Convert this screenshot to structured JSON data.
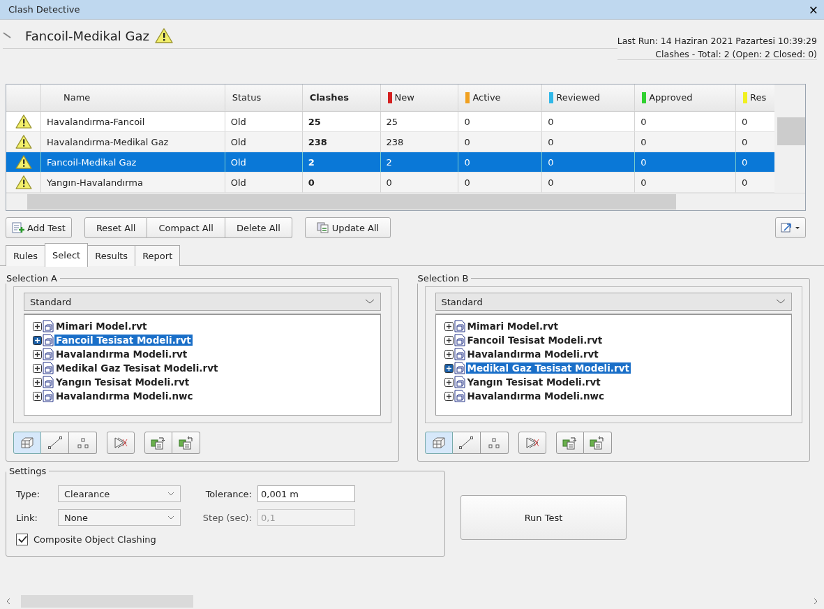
{
  "window": {
    "title": "Clash Detective",
    "close": "×"
  },
  "test": {
    "name": "Fancoil-Medikal Gaz",
    "last_run": "Last Run: 14 Haziran 2021 Pazartesi 10:39:29",
    "summary": "Clashes -  Total: 2  (Open: 2  Closed: 0)"
  },
  "table": {
    "columns": [
      {
        "label": "Name",
        "bold": false
      },
      {
        "label": "Status",
        "bold": false
      },
      {
        "label": "Clashes",
        "bold": true
      },
      {
        "label": "New",
        "bold": false,
        "color": "#d42020"
      },
      {
        "label": "Active",
        "bold": false,
        "color": "#f0a020"
      },
      {
        "label": "Reviewed",
        "bold": false,
        "color": "#30b8e8"
      },
      {
        "label": "Approved",
        "bold": false,
        "color": "#30d030"
      },
      {
        "label": "Res",
        "bold": false,
        "color": "#f0f020"
      }
    ],
    "rows": [
      {
        "selected": false,
        "cells": [
          "Havalandırma-Fancoil",
          "Old",
          "25",
          "25",
          "0",
          "0",
          "0",
          "0"
        ]
      },
      {
        "selected": false,
        "cells": [
          "Havalandırma-Medikal Gaz",
          "Old",
          "238",
          "238",
          "0",
          "0",
          "0",
          "0"
        ]
      },
      {
        "selected": true,
        "cells": [
          "Fancoil-Medikal Gaz",
          "Old",
          "2",
          "2",
          "0",
          "0",
          "0",
          "0"
        ]
      },
      {
        "selected": false,
        "cells": [
          "Yangın-Havalandırma",
          "Old",
          "0",
          "0",
          "0",
          "0",
          "0",
          "0"
        ]
      }
    ]
  },
  "toolbar": [
    [
      {
        "label": "Add Test",
        "kind": "add"
      }
    ],
    [
      {
        "label": "Reset All",
        "kind": "plain"
      },
      {
        "label": "Compact All",
        "kind": "plain"
      },
      {
        "label": "Delete All",
        "kind": "plain"
      }
    ],
    [
      {
        "label": "Update All",
        "kind": "update"
      }
    ]
  ],
  "tabs": [
    {
      "label": "Rules",
      "selected": false
    },
    {
      "label": "Select",
      "selected": true
    },
    {
      "label": "Results",
      "selected": false
    },
    {
      "label": "Report",
      "selected": false
    }
  ],
  "selections": [
    {
      "title": "Selection A",
      "dropdown": "Standard",
      "items": [
        {
          "label": "Mimari Model.rvt",
          "selected": false
        },
        {
          "label": "Fancoil Tesisat Modeli.rvt",
          "selected": true
        },
        {
          "label": "Havalandırma Modeli.rvt",
          "selected": false
        },
        {
          "label": "Medikal Gaz Tesisat Modeli.rvt",
          "selected": false
        },
        {
          "label": "Yangın Tesisat Modeli.rvt",
          "selected": false
        },
        {
          "label": "Havalandırma Modeli.nwc",
          "selected": false
        }
      ],
      "tool_groups": [
        [
          {
            "kind": "surface",
            "selected": true
          },
          {
            "kind": "line",
            "selected": false
          },
          {
            "kind": "points",
            "selected": false
          }
        ],
        [
          {
            "kind": "self",
            "selected": false
          }
        ],
        [
          {
            "kind": "use",
            "selected": false
          },
          {
            "kind": "save",
            "selected": false
          }
        ]
      ]
    },
    {
      "title": "Selection B",
      "dropdown": "Standard",
      "items": [
        {
          "label": "Mimari Model.rvt",
          "selected": false
        },
        {
          "label": "Fancoil Tesisat Modeli.rvt",
          "selected": false
        },
        {
          "label": "Havalandırma Modeli.rvt",
          "selected": false
        },
        {
          "label": "Medikal Gaz Tesisat Modeli.rvt",
          "selected": true
        },
        {
          "label": "Yangın Tesisat Modeli.rvt",
          "selected": false
        },
        {
          "label": "Havalandırma Modeli.nwc",
          "selected": false
        }
      ],
      "tool_groups": [
        [
          {
            "kind": "surface",
            "selected": true
          },
          {
            "kind": "line",
            "selected": false
          },
          {
            "kind": "points",
            "selected": false
          }
        ],
        [
          {
            "kind": "self",
            "selected": false
          }
        ],
        [
          {
            "kind": "use",
            "selected": false
          },
          {
            "kind": "save",
            "selected": false
          }
        ]
      ]
    }
  ],
  "settings": {
    "title": "Settings",
    "type_label": "Type:",
    "type": "Clearance",
    "tolerance_label": "Tolerance:",
    "tolerance": "0,001 m",
    "link_label": "Link:",
    "link": "None",
    "step_label": "Step (sec):",
    "step": "0,1",
    "step_disabled": true,
    "composite_label": "Composite Object Clashing",
    "composite_checked": true
  },
  "run_button": "Run Test"
}
